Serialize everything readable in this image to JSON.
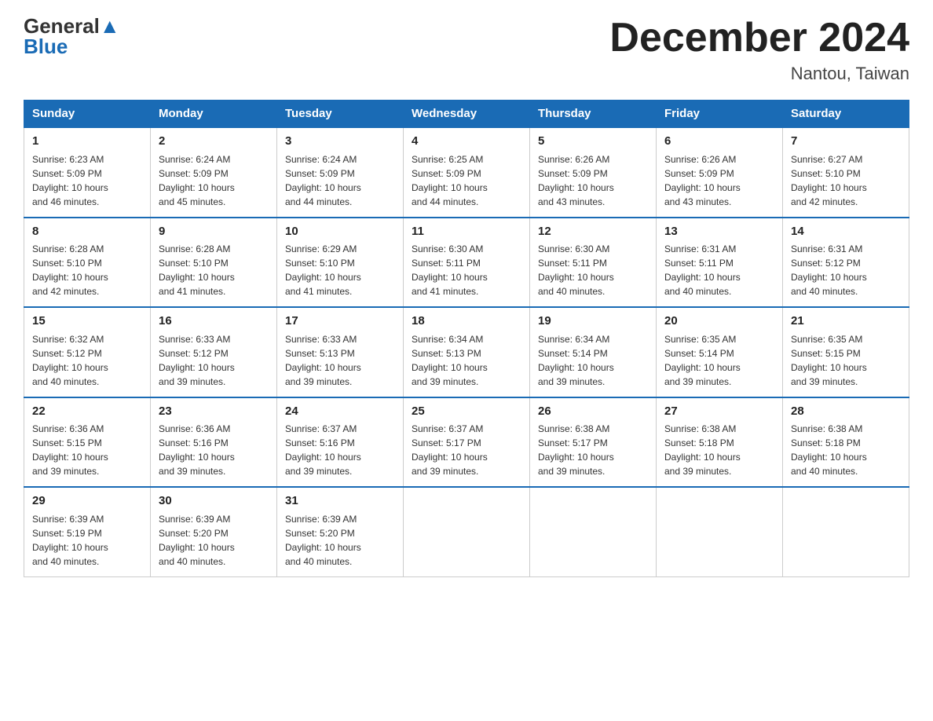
{
  "logo": {
    "general": "General",
    "blue": "Blue"
  },
  "header": {
    "title": "December 2024",
    "location": "Nantou, Taiwan"
  },
  "days": [
    "Sunday",
    "Monday",
    "Tuesday",
    "Wednesday",
    "Thursday",
    "Friday",
    "Saturday"
  ],
  "weeks": [
    [
      {
        "date": "1",
        "sunrise": "6:23 AM",
        "sunset": "5:09 PM",
        "daylight": "10 hours and 46 minutes."
      },
      {
        "date": "2",
        "sunrise": "6:24 AM",
        "sunset": "5:09 PM",
        "daylight": "10 hours and 45 minutes."
      },
      {
        "date": "3",
        "sunrise": "6:24 AM",
        "sunset": "5:09 PM",
        "daylight": "10 hours and 44 minutes."
      },
      {
        "date": "4",
        "sunrise": "6:25 AM",
        "sunset": "5:09 PM",
        "daylight": "10 hours and 44 minutes."
      },
      {
        "date": "5",
        "sunrise": "6:26 AM",
        "sunset": "5:09 PM",
        "daylight": "10 hours and 43 minutes."
      },
      {
        "date": "6",
        "sunrise": "6:26 AM",
        "sunset": "5:09 PM",
        "daylight": "10 hours and 43 minutes."
      },
      {
        "date": "7",
        "sunrise": "6:27 AM",
        "sunset": "5:10 PM",
        "daylight": "10 hours and 42 minutes."
      }
    ],
    [
      {
        "date": "8",
        "sunrise": "6:28 AM",
        "sunset": "5:10 PM",
        "daylight": "10 hours and 42 minutes."
      },
      {
        "date": "9",
        "sunrise": "6:28 AM",
        "sunset": "5:10 PM",
        "daylight": "10 hours and 41 minutes."
      },
      {
        "date": "10",
        "sunrise": "6:29 AM",
        "sunset": "5:10 PM",
        "daylight": "10 hours and 41 minutes."
      },
      {
        "date": "11",
        "sunrise": "6:30 AM",
        "sunset": "5:11 PM",
        "daylight": "10 hours and 41 minutes."
      },
      {
        "date": "12",
        "sunrise": "6:30 AM",
        "sunset": "5:11 PM",
        "daylight": "10 hours and 40 minutes."
      },
      {
        "date": "13",
        "sunrise": "6:31 AM",
        "sunset": "5:11 PM",
        "daylight": "10 hours and 40 minutes."
      },
      {
        "date": "14",
        "sunrise": "6:31 AM",
        "sunset": "5:12 PM",
        "daylight": "10 hours and 40 minutes."
      }
    ],
    [
      {
        "date": "15",
        "sunrise": "6:32 AM",
        "sunset": "5:12 PM",
        "daylight": "10 hours and 40 minutes."
      },
      {
        "date": "16",
        "sunrise": "6:33 AM",
        "sunset": "5:12 PM",
        "daylight": "10 hours and 39 minutes."
      },
      {
        "date": "17",
        "sunrise": "6:33 AM",
        "sunset": "5:13 PM",
        "daylight": "10 hours and 39 minutes."
      },
      {
        "date": "18",
        "sunrise": "6:34 AM",
        "sunset": "5:13 PM",
        "daylight": "10 hours and 39 minutes."
      },
      {
        "date": "19",
        "sunrise": "6:34 AM",
        "sunset": "5:14 PM",
        "daylight": "10 hours and 39 minutes."
      },
      {
        "date": "20",
        "sunrise": "6:35 AM",
        "sunset": "5:14 PM",
        "daylight": "10 hours and 39 minutes."
      },
      {
        "date": "21",
        "sunrise": "6:35 AM",
        "sunset": "5:15 PM",
        "daylight": "10 hours and 39 minutes."
      }
    ],
    [
      {
        "date": "22",
        "sunrise": "6:36 AM",
        "sunset": "5:15 PM",
        "daylight": "10 hours and 39 minutes."
      },
      {
        "date": "23",
        "sunrise": "6:36 AM",
        "sunset": "5:16 PM",
        "daylight": "10 hours and 39 minutes."
      },
      {
        "date": "24",
        "sunrise": "6:37 AM",
        "sunset": "5:16 PM",
        "daylight": "10 hours and 39 minutes."
      },
      {
        "date": "25",
        "sunrise": "6:37 AM",
        "sunset": "5:17 PM",
        "daylight": "10 hours and 39 minutes."
      },
      {
        "date": "26",
        "sunrise": "6:38 AM",
        "sunset": "5:17 PM",
        "daylight": "10 hours and 39 minutes."
      },
      {
        "date": "27",
        "sunrise": "6:38 AM",
        "sunset": "5:18 PM",
        "daylight": "10 hours and 39 minutes."
      },
      {
        "date": "28",
        "sunrise": "6:38 AM",
        "sunset": "5:18 PM",
        "daylight": "10 hours and 40 minutes."
      }
    ],
    [
      {
        "date": "29",
        "sunrise": "6:39 AM",
        "sunset": "5:19 PM",
        "daylight": "10 hours and 40 minutes."
      },
      {
        "date": "30",
        "sunrise": "6:39 AM",
        "sunset": "5:20 PM",
        "daylight": "10 hours and 40 minutes."
      },
      {
        "date": "31",
        "sunrise": "6:39 AM",
        "sunset": "5:20 PM",
        "daylight": "10 hours and 40 minutes."
      },
      null,
      null,
      null,
      null
    ]
  ],
  "labels": {
    "sunrise": "Sunrise:",
    "sunset": "Sunset:",
    "daylight": "Daylight:"
  }
}
